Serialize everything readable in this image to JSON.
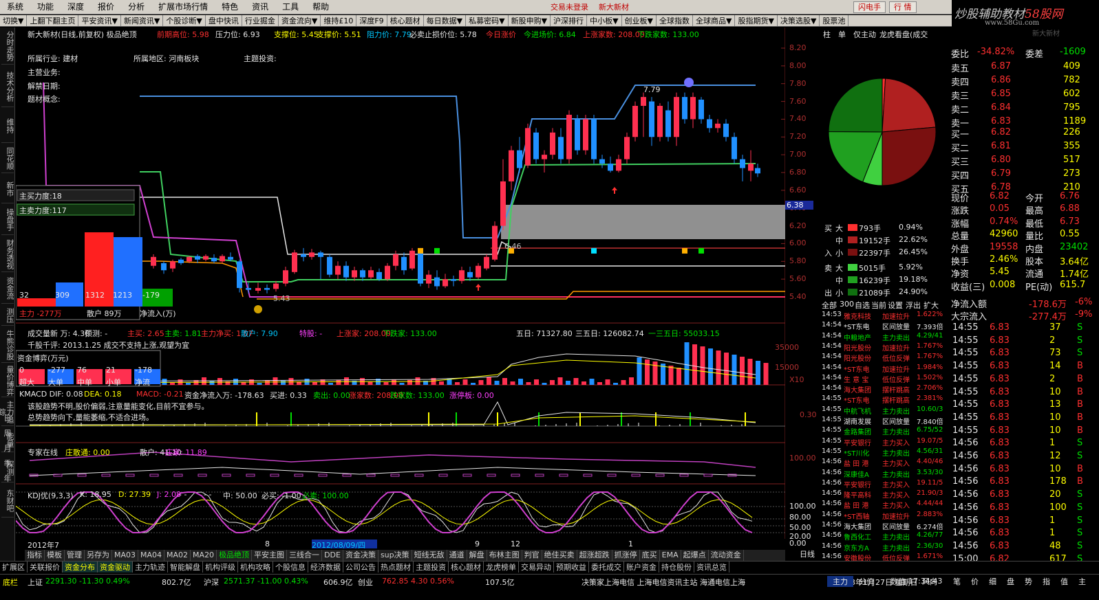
{
  "menu": {
    "items": [
      "系统",
      "功能",
      "深度",
      "报价",
      "分析",
      "扩展市场行情",
      "特色",
      "资讯",
      "工具",
      "帮助"
    ],
    "status_center": "交易未登录",
    "stock_title": "新大新材",
    "btn_flash": "闪电手",
    "btn_quote": "行 情"
  },
  "brand": {
    "text_a": "炒股辅助教材",
    "text_b": "58股网",
    "url": "www.58Gu.com"
  },
  "toolbar": [
    "切换▼",
    "上翻下翻主页",
    "平安资讯▼",
    "新闻资讯▼",
    "个股诊断▼",
    "盘中快讯",
    "行业掘金",
    "资金流向▼",
    "维持£10",
    "深度F9",
    "核心题材",
    "每日数据▼",
    "私募密码▼",
    "新股申购▼",
    "沪深排行",
    "中小板▼",
    "创业板▼",
    "全球指数",
    "全球商品▼",
    "股指期货▼",
    "决策选股▼",
    "股票池"
  ],
  "sidebar": {
    "tabs": [
      "分时走势",
      "技术分析",
      "维持",
      "同花顺",
      "新市",
      "操盘手",
      "财务透视",
      "资金流",
      "测压",
      "牛熊诊股",
      "量价博弈",
      "主力追踪",
      "能量",
      "探测",
      "东财吧"
    ],
    "periods": [
      "日",
      "周",
      "月",
      "季",
      "年"
    ],
    "icons": [
      "Im",
      "Fm",
      "Fd",
      "Fz",
      "Fb",
      "Fs",
      "RSI"
    ]
  },
  "chart": {
    "header": [
      {
        "t": "新大新材(日线,前复权) 极品绝顶",
        "c": "wht"
      },
      {
        "t": "前期高位: 5.98",
        "c": "red"
      },
      {
        "t": "压力位: 6.93",
        "c": "wht"
      },
      {
        "t": "支撑位: 5.45",
        "c": "yel"
      },
      {
        "t": "支撑价: 5.51",
        "c": "yel"
      },
      {
        "t": "阻力价: 7.79",
        "c": "cyn"
      },
      {
        "t": "必卖止损价位: 5.78",
        "c": "wht"
      },
      {
        "t": "今日涨价",
        "c": "red"
      },
      {
        "t": "今进场价: 6.84",
        "c": "grn"
      },
      {
        "t": "上涨家数: 208.00",
        "c": "red"
      },
      {
        "t": "下跌家数: 133.00",
        "c": "grn"
      }
    ],
    "info": [
      "所属行业: 建材",
      "所属地区: 河南板块",
      "主题投资:",
      "主营业务:",
      "解禁日期:",
      "题材概念:"
    ],
    "price_labels": [
      "7.79",
      "6.46",
      "5.43"
    ],
    "y_prices": [
      "8.20",
      "8.00",
      "7.80",
      "7.60",
      "7.40",
      "7.20",
      "7.00",
      "6.80",
      "6.60",
      "6.40",
      "6.20",
      "6.00",
      "5.80",
      "5.60",
      "5.40"
    ],
    "current_price_tag": "6.38",
    "overlay": {
      "buy": "主买力度:18",
      "sell": "主卖力度:117",
      "bars": [
        {
          "v": "32",
          "c": "#ff2020"
        },
        {
          "v": "309",
          "c": "#2070ff"
        },
        {
          "v": "1312",
          "c": "#ff2020"
        },
        {
          "v": "1213",
          "c": "#2070ff"
        },
        {
          "v": "-179",
          "c": "#00a000"
        }
      ],
      "labels": [
        "主力 -277万",
        "散户 89万",
        "净流入(万)"
      ]
    },
    "vol_header": [
      {
        "t": "成交量新 万: 4.30",
        "c": "wht"
      },
      {
        "t": "预测: -",
        "c": "wht"
      },
      {
        "t": "主买: 2.65",
        "c": "red"
      },
      {
        "t": "主卖: 1.81",
        "c": "grn"
      },
      {
        "t": "主力净买: 1.07",
        "c": "red"
      },
      {
        "t": "散户: 7.90",
        "c": "cyn"
      },
      {
        "t": "特股: -",
        "c": "mag"
      },
      {
        "t": "上涨家: 208.00",
        "c": "red"
      },
      {
        "t": "下跌家: 133.00",
        "c": "grn"
      }
    ],
    "vol_avgs": [
      "五日: 71327.80",
      "三五日: 126082.74",
      "一三五日: 55033.15"
    ],
    "vol_note": "千股千评: 2013.1.25 成交不支持上涨,观望为宜",
    "fund_box": {
      "title": "资金博弈(万元)",
      "vals": [
        "0",
        "-277",
        "76",
        "21",
        "-178"
      ],
      "labels": [
        "超大",
        "大单",
        "中单",
        "小单",
        "净流"
      ]
    },
    "vol_y": [
      "35000",
      "15000",
      "X10"
    ],
    "macd_header": [
      {
        "t": "KMACD DIF: 0.08",
        "c": "wht"
      },
      {
        "t": "DEA: 0.18",
        "c": "yel"
      },
      {
        "t": "MACD: -0.21",
        "c": "red"
      },
      {
        "t": "资金净流入万: -178.63",
        "c": "wht"
      },
      {
        "t": "买进: 0.33",
        "c": "wht"
      },
      {
        "t": "卖出: 0.00",
        "c": "grn"
      },
      {
        "t": "涨家数: 208.00",
        "c": "red"
      },
      {
        "t": "跌家数: 133.00",
        "c": "grn"
      },
      {
        "t": "涨停板: 0.00",
        "c": "mag"
      }
    ],
    "macd_note1": "该股趋势不明,股价偏弱,注意量能变化,目前不宜参与。",
    "macd_note2": "总势趋势向下,量能萎缩,不适合进场。",
    "macd_y": "0.30",
    "expert_header": [
      {
        "t": "专家在线",
        "c": "wht"
      },
      {
        "t": "庄散通: 0.00",
        "c": "yel"
      },
      {
        "t": "散户: 41.10",
        "c": "wht"
      },
      {
        "t": "庄家: 11.89",
        "c": "mag"
      }
    ],
    "expert_y": "100.00",
    "kdj_header": [
      {
        "t": "KDJ优(9,3,3)",
        "c": "wht"
      },
      {
        "t": "K: 18.95",
        "c": "wht"
      },
      {
        "t": "D: 27.39",
        "c": "yel"
      },
      {
        "t": "J: 2.08",
        "c": "mag"
      },
      {
        "t": "- -",
        "c": "wht"
      },
      {
        "t": "- -",
        "c": "wht"
      },
      {
        "t": "中: 50.00",
        "c": "wht"
      },
      {
        "t": "必买: -1.00",
        "c": "wht"
      },
      {
        "t": "必卖: 100.00",
        "c": "grn"
      }
    ],
    "kdj_y": [
      "100.00",
      "80.00",
      "50.00",
      "20.00",
      "0.00"
    ],
    "xaxis": [
      {
        "t": "2012年7",
        "c": "wht"
      },
      {
        "t": "8",
        "c": "wht"
      },
      {
        "t": "2012/08/09/四",
        "c": "cyn"
      },
      {
        "t": "9",
        "c": "wht"
      },
      {
        "t": "12",
        "c": "wht"
      },
      {
        "t": "1",
        "c": "wht"
      }
    ],
    "period_label": "日线"
  },
  "panel": {
    "tabs": [
      "柱",
      "单",
      "仅主动",
      "龙虎看盘(成交"
    ],
    "flow": [
      {
        "side": "买",
        "size": "大",
        "vol": "793手",
        "pct": "0.94%",
        "c": "#ff3030"
      },
      {
        "side": "",
        "size": "中",
        "vol": "19152手",
        "pct": "22.62%",
        "c": "#b02020"
      },
      {
        "side": "入",
        "size": "小",
        "vol": "22397手",
        "pct": "26.45%",
        "c": "#7a1010"
      },
      {
        "side": "卖",
        "size": "大",
        "vol": "5015手",
        "pct": "5.92%",
        "c": "#40d040"
      },
      {
        "side": "",
        "size": "中",
        "vol": "16239手",
        "pct": "19.18%",
        "c": "#20a020"
      },
      {
        "side": "出",
        "size": "小",
        "vol": "21089手",
        "pct": "24.90%",
        "c": "#107010"
      }
    ],
    "list_tabs": [
      "全部",
      "300",
      "自选",
      "当前",
      "设置",
      "浮出",
      "扩大"
    ],
    "news": [
      {
        "time": "14:53",
        "name": "雅克科技",
        "act": "加速拉升",
        "v": "1.622%",
        "c": "red"
      },
      {
        "time": "14:54",
        "name": "*ST东电",
        "act": "区间放量",
        "v": "7.393倍",
        "c": "wht"
      },
      {
        "time": "14:54",
        "name": "中粮地产",
        "act": "主力卖出",
        "v": "4.29/41",
        "c": "grn"
      },
      {
        "time": "14:54",
        "name": "阳光股份",
        "act": "加速拉升",
        "v": "1.767%",
        "c": "red"
      },
      {
        "time": "14:54",
        "name": "阳光股份",
        "act": "低位反弹",
        "v": "1.767%",
        "c": "red"
      },
      {
        "time": "14:54",
        "name": "*ST东电",
        "act": "加速拉升",
        "v": "1.984%",
        "c": "red"
      },
      {
        "time": "14:54",
        "name": "生 意 宝",
        "act": "低位反弹",
        "v": "1.502%",
        "c": "red"
      },
      {
        "time": "14:54",
        "name": "海大集团",
        "act": "摆杆跳高",
        "v": "2.706%",
        "c": "red"
      },
      {
        "time": "14:55",
        "name": "*ST东电",
        "act": "摆杆跳高",
        "v": "2.381%",
        "c": "red"
      },
      {
        "time": "14:55",
        "name": "中航飞机",
        "act": "主力卖出",
        "v": "10.60/3",
        "c": "grn"
      },
      {
        "time": "14:55",
        "name": "湖南发展",
        "act": "区间放量",
        "v": "7.840倍",
        "c": "wht"
      },
      {
        "time": "14:55",
        "name": "金路集团",
        "act": "主力卖出",
        "v": "6.75/52",
        "c": "grn"
      },
      {
        "time": "14:55",
        "name": "平安银行",
        "act": "主力买入",
        "v": "19.07/5",
        "c": "red"
      },
      {
        "time": "14:55",
        "name": "*ST川化",
        "act": "主力卖出",
        "v": "4.56/31",
        "c": "grn"
      },
      {
        "time": "14:56",
        "name": "盐 田 港",
        "act": "主力买入",
        "v": "4.40/46",
        "c": "red"
      },
      {
        "time": "14:56",
        "name": "深康佳A",
        "act": "主力卖出",
        "v": "3.53/30",
        "c": "grn"
      },
      {
        "time": "14:56",
        "name": "平安银行",
        "act": "主力买入",
        "v": "19.11/5",
        "c": "red"
      },
      {
        "time": "14:56",
        "name": "隆平高科",
        "act": "主力买入",
        "v": "21.90/3",
        "c": "red"
      },
      {
        "time": "14:56",
        "name": "盐 田 港",
        "act": "主力买入",
        "v": "4.44/44",
        "c": "red"
      },
      {
        "time": "14:56",
        "name": "*ST西轴",
        "act": "加速拉升",
        "v": "2.883%",
        "c": "red"
      },
      {
        "time": "14:56",
        "name": "海大集团",
        "act": "区间放量",
        "v": "6.274倍",
        "c": "wht"
      },
      {
        "time": "14:56",
        "name": "鲁西化工",
        "act": "主力卖出",
        "v": "4.26/77",
        "c": "grn"
      },
      {
        "time": "14:56",
        "name": "京东方A",
        "act": "主力卖出",
        "v": "2.36/30",
        "c": "grn"
      },
      {
        "time": "14:56",
        "name": "安徽股份",
        "act": "低位反弹",
        "v": "1.671%",
        "c": "red"
      }
    ],
    "pie": [
      {
        "pct": 0.94,
        "c": "#ff3030"
      },
      {
        "pct": 22.62,
        "c": "#b02020"
      },
      {
        "pct": 26.45,
        "c": "#7a1010"
      },
      {
        "pct": 5.92,
        "c": "#40d040"
      },
      {
        "pct": 19.18,
        "c": "#20a020"
      },
      {
        "pct": 24.9,
        "c": "#107010"
      }
    ]
  },
  "quote": {
    "header_faded": "新大新材",
    "weibi": {
      "l1": "委比",
      "v1": "-34.82%",
      "l2": "委差",
      "v2": "-1609"
    },
    "asks": [
      {
        "l": "卖五",
        "p": "6.87",
        "v": "409"
      },
      {
        "l": "卖四",
        "p": "6.86",
        "v": "782"
      },
      {
        "l": "卖三",
        "p": "6.85",
        "v": "602"
      },
      {
        "l": "卖二",
        "p": "6.84",
        "v": "795"
      },
      {
        "l": "卖一",
        "p": "6.83",
        "v": "1189"
      }
    ],
    "bids": [
      {
        "l": "买一",
        "p": "6.82",
        "v": "226"
      },
      {
        "l": "买二",
        "p": "6.81",
        "v": "355"
      },
      {
        "l": "买三",
        "p": "6.80",
        "v": "517"
      },
      {
        "l": "买四",
        "p": "6.79",
        "v": "273"
      },
      {
        "l": "买五",
        "p": "6.78",
        "v": "210"
      }
    ],
    "stats": [
      {
        "l1": "现价",
        "v1": "6.82",
        "c1": "red",
        "l2": "今开",
        "v2": "6.76",
        "c2": "red"
      },
      {
        "l1": "涨跌",
        "v1": "0.05",
        "c1": "red",
        "l2": "最高",
        "v2": "6.88",
        "c2": "red"
      },
      {
        "l1": "涨幅",
        "v1": "0.74%",
        "c1": "red",
        "l2": "最低",
        "v2": "6.73",
        "c2": "red"
      },
      {
        "l1": "总量",
        "v1": "42960",
        "c1": "yel",
        "l2": "量比",
        "v2": "0.55",
        "c2": "yel"
      },
      {
        "l1": "外盘",
        "v1": "19558",
        "c1": "red",
        "l2": "内盘",
        "v2": "23402",
        "c2": "grn"
      },
      {
        "l1": "换手",
        "v1": "2.46%",
        "c1": "yel",
        "l2": "股本",
        "v2": "3.64亿",
        "c2": "yel"
      },
      {
        "l1": "净资",
        "v1": "5.45",
        "c1": "yel",
        "l2": "流通",
        "v2": "1.74亿",
        "c2": "yel"
      },
      {
        "l1": "收益(三)",
        "v1": "0.008",
        "c1": "yel",
        "l2": "PE(动)",
        "v2": "615.7",
        "c2": "yel"
      }
    ],
    "netflow": [
      {
        "l": "净流入额",
        "v": "-178.6万",
        "p": "-6%"
      },
      {
        "l": "大宗流入",
        "v": "-277.4万",
        "p": "-9%"
      }
    ],
    "ticks": [
      {
        "t": "14:55",
        "p": "6.83",
        "v": "37",
        "s": "S"
      },
      {
        "t": "14:55",
        "p": "6.83",
        "v": "2",
        "s": "S"
      },
      {
        "t": "14:55",
        "p": "6.83",
        "v": "73",
        "s": "S"
      },
      {
        "t": "14:55",
        "p": "6.83",
        "v": "14",
        "s": "B"
      },
      {
        "t": "14:55",
        "p": "6.83",
        "v": "2",
        "s": "B"
      },
      {
        "t": "14:55",
        "p": "6.83",
        "v": "10",
        "s": "B"
      },
      {
        "t": "14:55",
        "p": "6.83",
        "v": "13",
        "s": "B"
      },
      {
        "t": "14:55",
        "p": "6.83",
        "v": "10",
        "s": "B"
      },
      {
        "t": "14:55",
        "p": "6.83",
        "v": "10",
        "s": "B"
      },
      {
        "t": "14:56",
        "p": "6.83",
        "v": "1",
        "s": "S"
      },
      {
        "t": "14:56",
        "p": "6.83",
        "v": "12",
        "s": "S"
      },
      {
        "t": "14:56",
        "p": "6.83",
        "v": "10",
        "s": "B"
      },
      {
        "t": "14:56",
        "p": "6.83",
        "v": "178",
        "s": "B"
      },
      {
        "t": "14:56",
        "p": "6.83",
        "v": "20",
        "s": "S"
      },
      {
        "t": "14:56",
        "p": "6.83",
        "v": "100",
        "s": "S"
      },
      {
        "t": "14:56",
        "p": "6.83",
        "v": "1",
        "s": "S"
      },
      {
        "t": "14:56",
        "p": "6.83",
        "v": "1",
        "s": "S"
      },
      {
        "t": "14:56",
        "p": "6.83",
        "v": "48",
        "s": "S"
      },
      {
        "t": "15:00",
        "p": "6.82",
        "v": "617",
        "s": "S"
      }
    ]
  },
  "bottom_tabs": [
    "指标",
    "模板",
    "管理",
    "另存为",
    "MA03",
    "MA04",
    "MA02",
    "MA20",
    "极品绝顶",
    "平安主图",
    "三线合一",
    "DDE",
    "资金决策",
    "sup决策",
    "短线无敌",
    "通道",
    "解盘",
    "布林主图",
    "判官",
    "绝佳买卖",
    "超涨超跌",
    "抓涨停",
    "底买",
    "EMA",
    "起爆点",
    "流动资金"
  ],
  "row2_tabs": [
    "扩展区",
    "关联报价",
    "资金分布",
    "资金驱动",
    "主力轨迹",
    "智能解盘",
    "机构评级",
    "机构攻略",
    "个股信息",
    "经济数据",
    "公司公告",
    "热点题材",
    "主题投资",
    "核心题材",
    "龙虎榜单",
    "交易异动",
    "预期收益",
    "委托成交",
    "账户资金",
    "持仓股份",
    "资讯总览"
  ],
  "right_tabs": [
    "主力",
    "分价",
    "数值",
    "风向"
  ],
  "quote_tabs": [
    "笔",
    "价",
    "细",
    "盘",
    "势",
    "指",
    "值",
    "主"
  ],
  "status": {
    "item1": "底栏",
    "sh_name": "上证",
    "sh_vals": "2291.30 -11.30 0.49%",
    "sh_amt": "802.7亿",
    "sz_name": "沪深",
    "sz_vals": "2571.37 -11.00 0.43%",
    "sz_amt": "606.9亿",
    "cy_name": "创业",
    "cy_vals": "762.85 4.30 0.56%",
    "cy_amt": "107.5亿",
    "ticker": "决策家上海电信 上海电信资讯主站 海通电信上海",
    "date": "2013年1月27日 星期日",
    "time": "17:34:43"
  }
}
